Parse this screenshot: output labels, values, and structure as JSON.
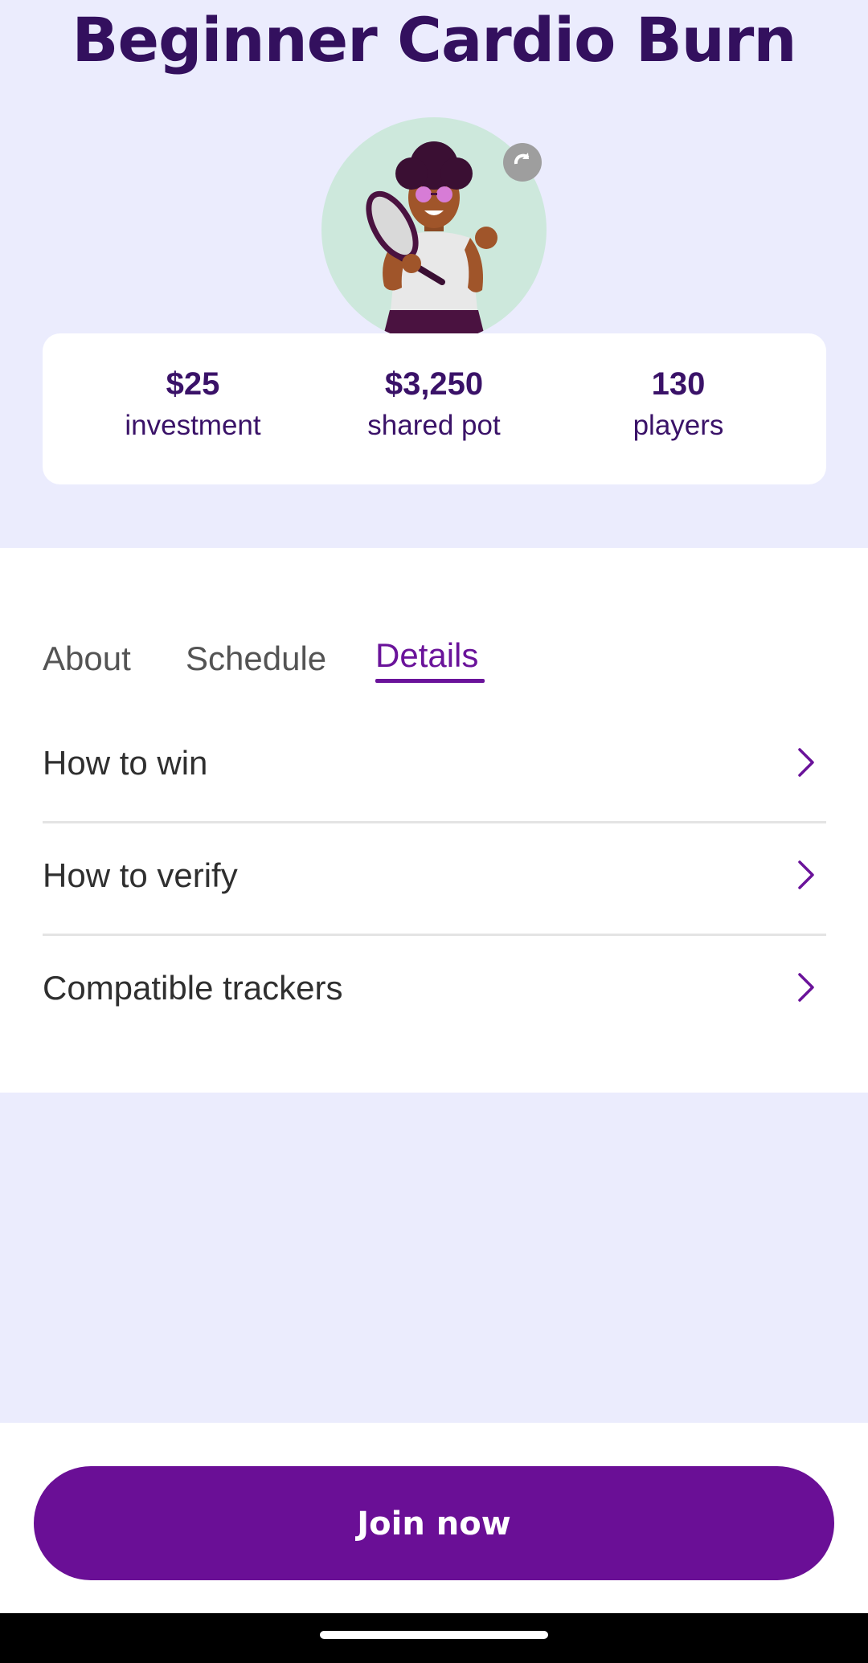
{
  "header": {
    "title": "Beginner Cardio Burn"
  },
  "stats": [
    {
      "value": "$25",
      "label": "investment"
    },
    {
      "value": "$3,250",
      "label": "shared pot"
    },
    {
      "value": "130",
      "label": "players"
    }
  ],
  "tabs": [
    {
      "label": "About",
      "active": false
    },
    {
      "label": "Schedule",
      "active": false
    },
    {
      "label": "Details",
      "active": true
    }
  ],
  "details": [
    {
      "label": "How to win",
      "icon": "chevron-right-icon"
    },
    {
      "label": "How to verify",
      "icon": "chevron-right-icon"
    },
    {
      "label": "Compatible trackers",
      "icon": "chevron-right-icon"
    }
  ],
  "footer": {
    "join_label": "Join now"
  },
  "colors": {
    "background": "#ebecfd",
    "title": "#33105e",
    "accent": "#6a0f96",
    "avatar_bg": "#cde8dc"
  }
}
